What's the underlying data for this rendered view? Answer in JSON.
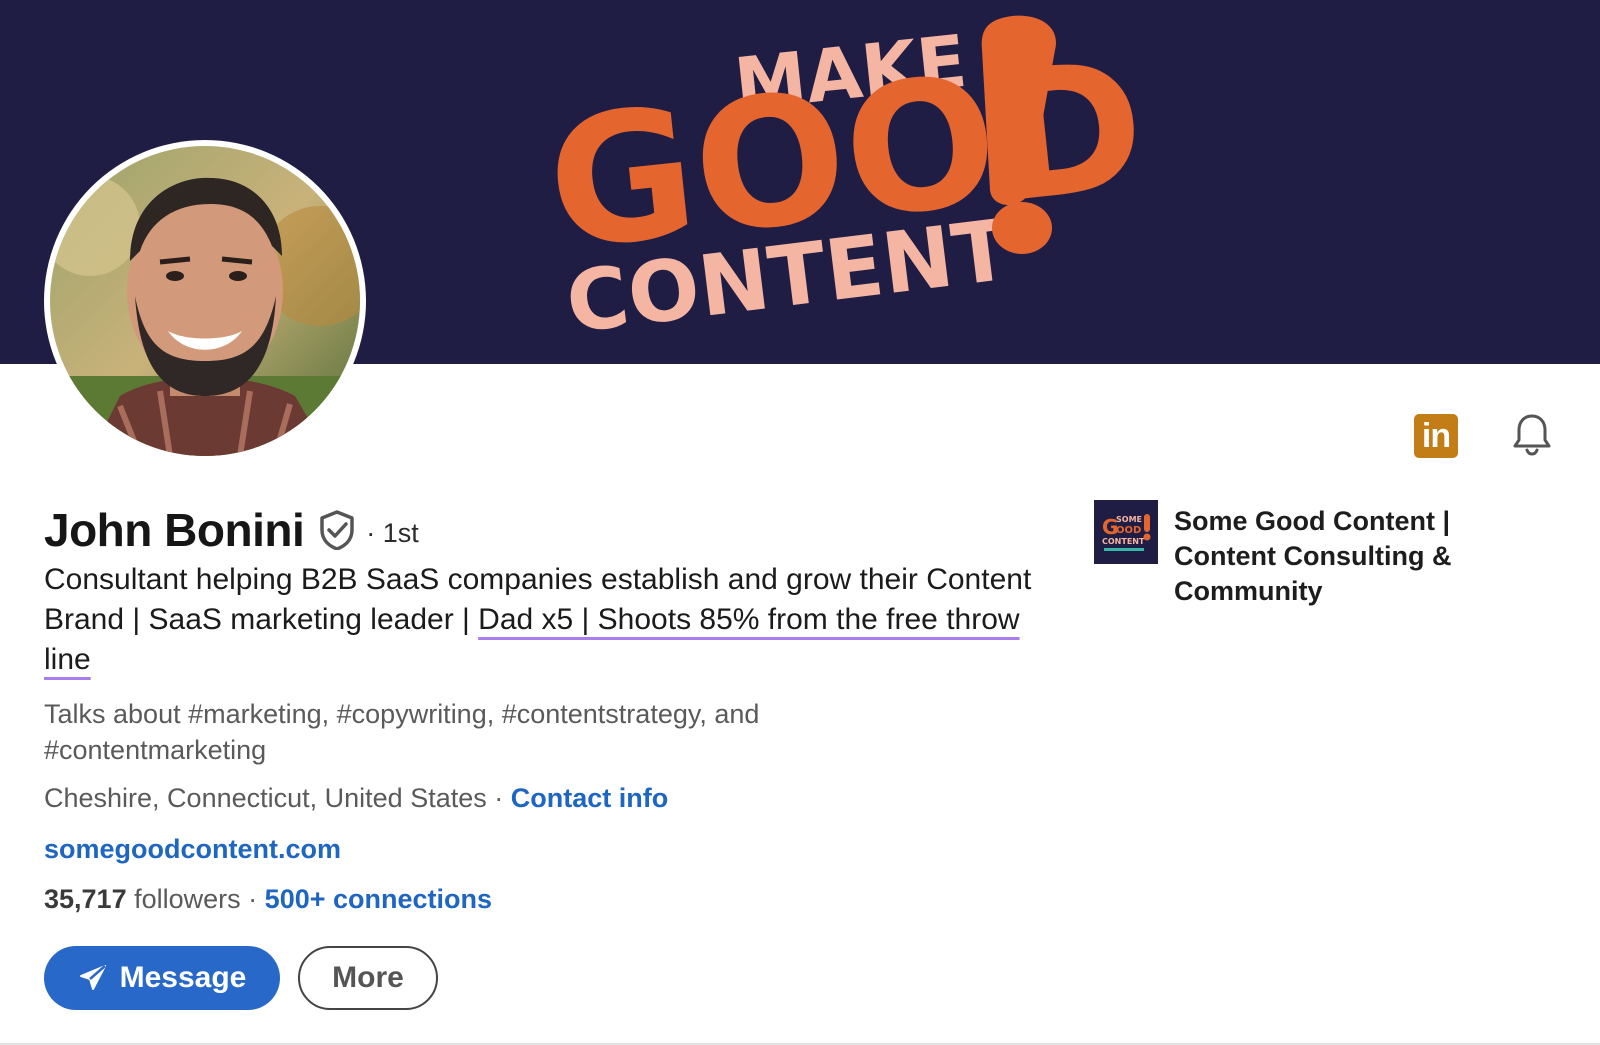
{
  "banner": {
    "line1": "MAKE",
    "line2": "GOOD",
    "line3": "CONTENT",
    "exclamation": "!",
    "bg_color": "#201d45",
    "orange": "#e5652e",
    "pink": "#f4b5a3"
  },
  "header_icons": {
    "linkedin_badge": "in",
    "linkedin_icon": "linkedin-icon",
    "bell_icon": "bell-icon"
  },
  "profile": {
    "name": "John Bonini",
    "verified_icon": "shield-check-icon",
    "degree": "· 1st",
    "headline_part1": "Consultant helping B2B SaaS companies establish and grow their Content Brand | SaaS marketing leader | ",
    "headline_part2": "Dad x5 | Shoots 85% from the free throw line",
    "talks_about": "Talks about #marketing, #copywriting, #contentstrategy, and #contentmarketing",
    "location": "Cheshire, Connecticut, United States",
    "location_sep": " · ",
    "contact_info": "Contact info",
    "website": "somegoodcontent.com",
    "followers_count": "35,717",
    "followers_label": "followers",
    "stats_sep": " · ",
    "connections": "500+ connections"
  },
  "actions": {
    "message_label": "Message",
    "message_icon": "send-icon",
    "more_label": "More"
  },
  "company": {
    "name": "Some Good Content | Content Consulting & Community",
    "logo_icon": "company-logo-icon",
    "logo_text": "SOME GOOD CONTENT"
  },
  "colors": {
    "link": "#1e66c2",
    "button": "#2868c8",
    "underline": "#a77df0",
    "linkedin_badge": "#c37d16"
  }
}
